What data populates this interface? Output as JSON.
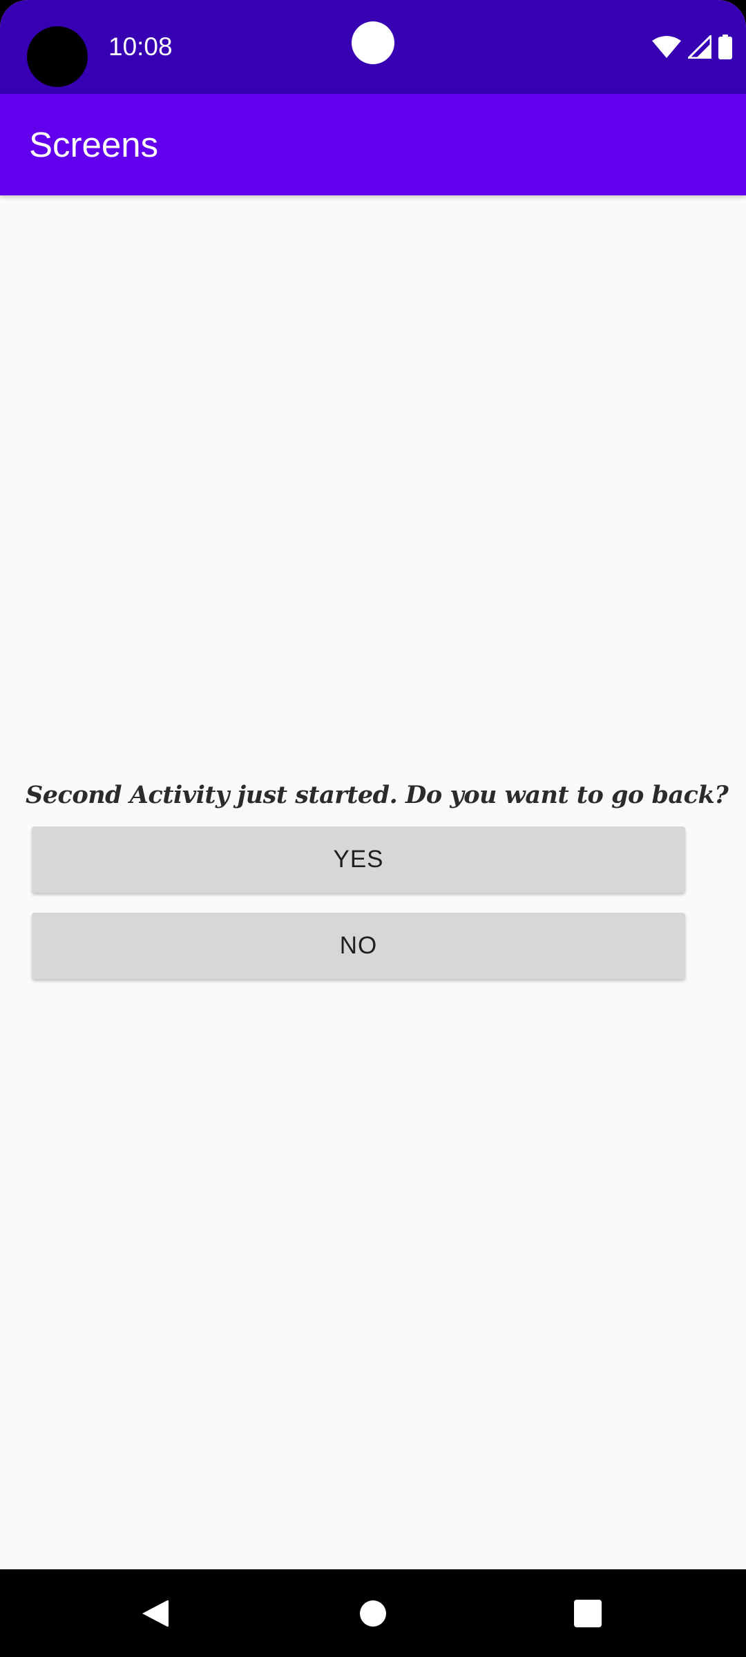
{
  "status_bar": {
    "time": "10:08",
    "icons": [
      "wifi-icon",
      "signal-icon",
      "battery-icon"
    ],
    "background": "#3700b3"
  },
  "app_bar": {
    "title": "Screens",
    "background": "#6200ee"
  },
  "content": {
    "prompt": "Second Activity just started. Do you want to go back?",
    "buttons": {
      "yes": "YES",
      "no": "NO"
    }
  },
  "nav_bar": {
    "icons": [
      "back-icon",
      "home-icon",
      "recents-icon"
    ]
  }
}
